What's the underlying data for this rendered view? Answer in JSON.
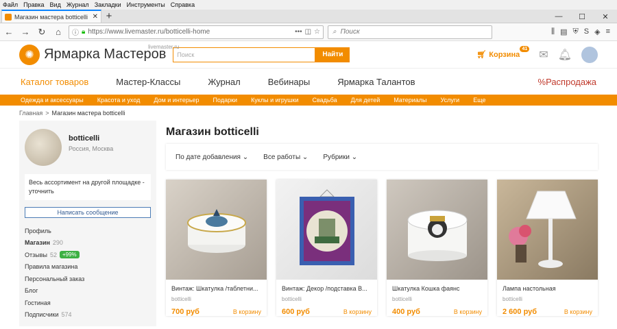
{
  "browser": {
    "menu": [
      "Файл",
      "Правка",
      "Вид",
      "Журнал",
      "Закладки",
      "Инструменты",
      "Справка"
    ],
    "tab_title": "Магазин мастера botticelli (b...",
    "url": "https://www.livemaster.ru/botticelli-home",
    "search_placeholder": "Поиск"
  },
  "site": {
    "logo_text": "Ярмарка Мастеров",
    "logo_sub": "livemaster.ru",
    "search_placeholder": "Поиск",
    "search_button": "Найти",
    "cart_label": "Корзина",
    "cart_count": "41",
    "nav": [
      "Каталог товаров",
      "Мастер-Классы",
      "Журнал",
      "Вебинары",
      "Ярмарка Талантов"
    ],
    "nav_sale": "%Распродажа",
    "categories": [
      "Одежда и аксессуары",
      "Красота и уход",
      "Дом и интерьер",
      "Подарки",
      "Куклы и игрушки",
      "Свадьба",
      "Для детей",
      "Материалы",
      "Услуги",
      "Еще"
    ],
    "breadcrumb_home": "Главная",
    "breadcrumb_sep": ">",
    "breadcrumb_current": "Магазин мастера botticelli"
  },
  "sidebar": {
    "name": "botticelli",
    "location": "Россия, Москва",
    "note": "Весь ассортимент на другой площадке - уточнить",
    "message_button": "Написать сообщение",
    "items": [
      {
        "label": "Профиль",
        "count": ""
      },
      {
        "label": "Магазин",
        "count": "290"
      },
      {
        "label": "Отзывы",
        "count": "52",
        "badge": "+99%"
      },
      {
        "label": "Правила магазина",
        "count": ""
      },
      {
        "label": "Персональный заказ",
        "count": ""
      },
      {
        "label": "Блог",
        "count": ""
      },
      {
        "label": "Гостиная",
        "count": ""
      },
      {
        "label": "Подписчики",
        "count": "574"
      }
    ]
  },
  "main": {
    "title": "Магазин botticelli",
    "filters": [
      "По дате добавления",
      "Все работы",
      "Рубрики"
    ],
    "products": [
      {
        "title": "Винтаж: Шкатулка /таблетни...",
        "shop": "botticelli",
        "price": "700 руб",
        "buy": "В корзину"
      },
      {
        "title": "Винтаж: Декор /подставка В...",
        "shop": "botticelli",
        "price": "600 руб",
        "buy": "В корзину"
      },
      {
        "title": "Шкатулка Кошка фаянс",
        "shop": "botticelli",
        "price": "400 руб",
        "buy": "В корзину"
      },
      {
        "title": "Лампа настольная",
        "shop": "botticelli",
        "price": "2 600 руб",
        "buy": "В корзину"
      }
    ]
  },
  "colors": {
    "accent": "#f28c00",
    "sale": "#c0392b",
    "badge": "#3cb043"
  }
}
